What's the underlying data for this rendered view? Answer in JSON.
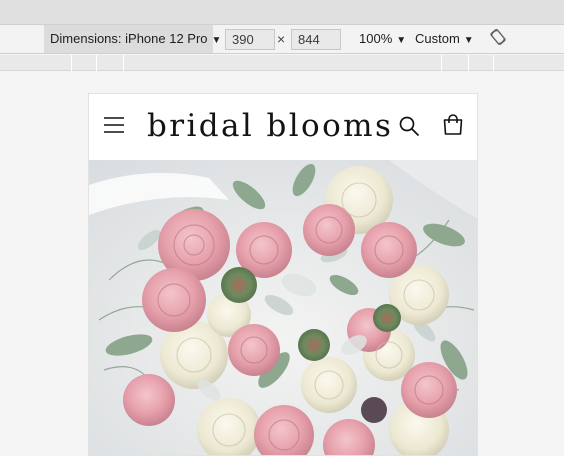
{
  "devtools": {
    "dimensions_label": "Dimensions: iPhone 12 Pro",
    "width_value": "390",
    "height_value": "844",
    "times_symbol": "×",
    "zoom_label": "100%",
    "throttle_label": "Custom",
    "caret": "▼",
    "icons": [
      "rotate-icon"
    ]
  },
  "site": {
    "logo_text": "bridal blooms",
    "icons": [
      "menu-icon",
      "search-icon",
      "cart-icon"
    ],
    "hero_image": "bouquet of pink and white roses with succulents and eucalyptus",
    "colors": {
      "text": "#141414",
      "rose_pink": "#e7a1ac",
      "cream": "#f2eedb",
      "leaf": "#7a9a80"
    }
  }
}
